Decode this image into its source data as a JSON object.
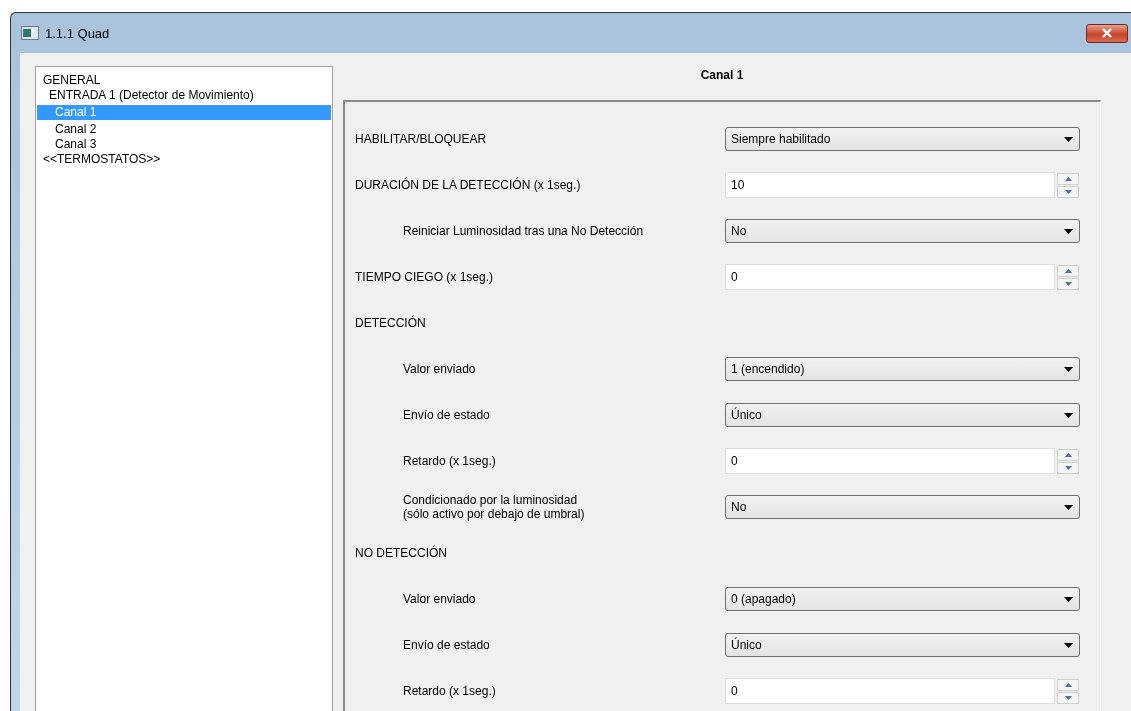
{
  "window": {
    "title": "1.1.1 Quad"
  },
  "sidebar": {
    "items": [
      {
        "label": "GENERAL",
        "selected": false,
        "children": [
          {
            "label": "ENTRADA 1 (Detector de Movimiento)",
            "selected": false,
            "children": [
              {
                "label": "Canal 1",
                "selected": true
              },
              {
                "label": "Canal 2",
                "selected": false
              },
              {
                "label": "Canal 3",
                "selected": false
              }
            ]
          }
        ]
      },
      {
        "label": "<<TERMOSTATOS>>",
        "selected": false
      }
    ]
  },
  "panel": {
    "title": "Canal 1",
    "rows": [
      {
        "kind": "dropdown",
        "label": "HABILITAR/BLOQUEAR",
        "value": "Siempre habilitado"
      },
      {
        "kind": "spin",
        "label": "DURACIÓN DE LA DETECCIÓN (x 1seg.)",
        "value": "10",
        "children": [
          {
            "kind": "dropdown",
            "label": "Reiniciar Luminosidad tras una No Detección",
            "value": "No"
          }
        ]
      },
      {
        "kind": "spin",
        "label": "TIEMPO CIEGO (x 1seg.)",
        "value": "0"
      },
      {
        "kind": "heading",
        "label": "DETECCIÓN",
        "children": [
          {
            "kind": "dropdown",
            "label": "Valor enviado",
            "value": "1 (encendido)"
          },
          {
            "kind": "dropdown",
            "label": "Envío de estado",
            "value": "Único"
          },
          {
            "kind": "spin",
            "label": "Retardo (x 1seg.)",
            "value": "0"
          },
          {
            "kind": "dropdown",
            "label": "Condicionado por la luminosidad\n(sólo activo por debajo de umbral)",
            "value": "No"
          }
        ]
      },
      {
        "kind": "heading",
        "label": "NO DETECCIÓN",
        "children": [
          {
            "kind": "dropdown",
            "label": "Valor enviado",
            "value": "0 (apagado)"
          },
          {
            "kind": "dropdown",
            "label": "Envío de estado",
            "value": "Único"
          },
          {
            "kind": "spin",
            "label": "Retardo (x 1seg.)",
            "value": "0"
          }
        ]
      }
    ]
  }
}
